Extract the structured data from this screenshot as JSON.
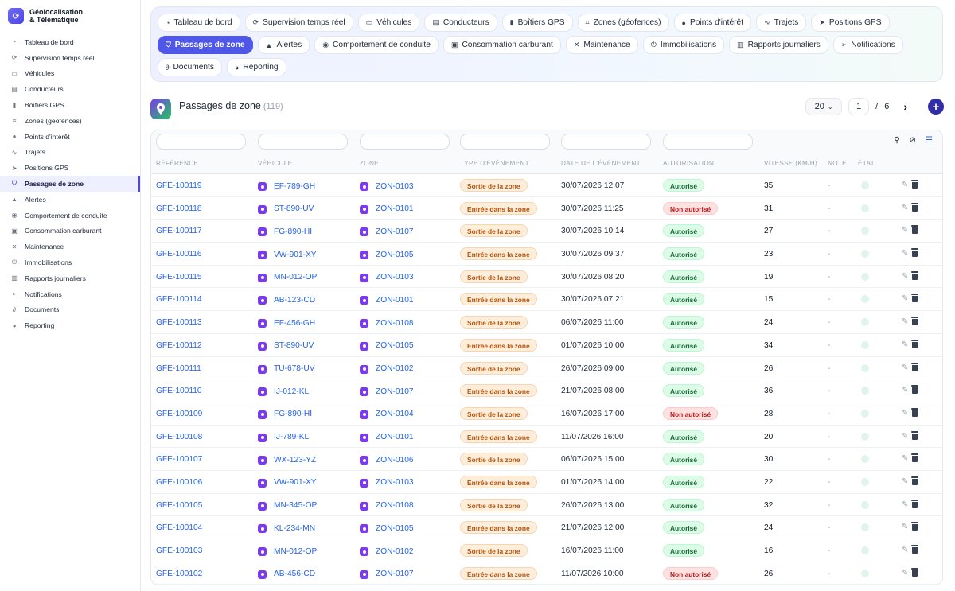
{
  "brand": {
    "line1": "Géolocalisation",
    "line2": "& Télématique"
  },
  "sidebar": {
    "items": [
      {
        "label": "Tableau de bord",
        "icon": "gauge-icon",
        "glyph": "◔"
      },
      {
        "label": "Supervision temps réel",
        "icon": "satellite-icon",
        "glyph": "⟳"
      },
      {
        "label": "Véhicules",
        "icon": "car-icon",
        "glyph": "▭"
      },
      {
        "label": "Conducteurs",
        "icon": "id-card-icon",
        "glyph": "▤"
      },
      {
        "label": "Boîtiers GPS",
        "icon": "device-icon",
        "glyph": "▮"
      },
      {
        "label": "Zones (géofences)",
        "icon": "map-icon",
        "glyph": "⌗"
      },
      {
        "label": "Points d'intérêt",
        "icon": "pin-icon",
        "glyph": "●"
      },
      {
        "label": "Trajets",
        "icon": "route-icon",
        "glyph": "∿"
      },
      {
        "label": "Positions GPS",
        "icon": "navigation-icon",
        "glyph": "➤"
      },
      {
        "label": "Passages de zone",
        "icon": "shield-icon",
        "glyph": "⛉",
        "active": true
      },
      {
        "label": "Alertes",
        "icon": "bell-icon",
        "glyph": "▲"
      },
      {
        "label": "Comportement de conduite",
        "icon": "steering-icon",
        "glyph": "◉"
      },
      {
        "label": "Consommation carburant",
        "icon": "fuel-icon",
        "glyph": "▣"
      },
      {
        "label": "Maintenance",
        "icon": "wrench-icon",
        "glyph": "✕"
      },
      {
        "label": "Immobilisations",
        "icon": "power-icon",
        "glyph": "⏻"
      },
      {
        "label": "Rapports journaliers",
        "icon": "file-icon",
        "glyph": "▥"
      },
      {
        "label": "Notifications",
        "icon": "send-icon",
        "glyph": "➢"
      },
      {
        "label": "Documents",
        "icon": "paperclip-icon",
        "glyph": "∂"
      },
      {
        "label": "Reporting",
        "icon": "pie-chart-icon",
        "glyph": "◕"
      }
    ]
  },
  "tabs": [
    {
      "label": "Tableau de bord",
      "icon": "gauge-icon",
      "glyph": "◔"
    },
    {
      "label": "Supervision temps réel",
      "icon": "satellite-icon",
      "glyph": "⟳"
    },
    {
      "label": "Véhicules",
      "icon": "car-icon",
      "glyph": "▭"
    },
    {
      "label": "Conducteurs",
      "icon": "id-card-icon",
      "glyph": "▤"
    },
    {
      "label": "Boîtiers GPS",
      "icon": "device-icon",
      "glyph": "▮"
    },
    {
      "label": "Zones (géofences)",
      "icon": "map-icon",
      "glyph": "⌗"
    },
    {
      "label": "Points d'intérêt",
      "icon": "pin-icon",
      "glyph": "●"
    },
    {
      "label": "Trajets",
      "icon": "route-icon",
      "glyph": "∿"
    },
    {
      "label": "Positions GPS",
      "icon": "navigation-icon",
      "glyph": "➤"
    },
    {
      "label": "Passages de zone",
      "icon": "shield-icon",
      "glyph": "⛉",
      "active": true
    },
    {
      "label": "Alertes",
      "icon": "bell-icon",
      "glyph": "▲"
    },
    {
      "label": "Comportement de conduite",
      "icon": "steering-icon",
      "glyph": "◉"
    },
    {
      "label": "Consommation carburant",
      "icon": "fuel-icon",
      "glyph": "▣"
    },
    {
      "label": "Maintenance",
      "icon": "wrench-icon",
      "glyph": "✕"
    },
    {
      "label": "Immobilisations",
      "icon": "power-icon",
      "glyph": "⏻"
    },
    {
      "label": "Rapports journaliers",
      "icon": "file-icon",
      "glyph": "▥"
    },
    {
      "label": "Notifications",
      "icon": "send-icon",
      "glyph": "➢"
    },
    {
      "label": "Documents",
      "icon": "paperclip-icon",
      "glyph": "∂"
    },
    {
      "label": "Reporting",
      "icon": "pie-chart-icon",
      "glyph": "◕"
    }
  ],
  "page": {
    "title": "Passages de zone",
    "count": "(119)"
  },
  "pager": {
    "page_size": "20",
    "page": "1",
    "sep": "/",
    "total_pages": "6"
  },
  "table": {
    "columns": [
      "RÉFÉRENCE",
      "VÉHICULE",
      "ZONE",
      "TYPE D'ÉVÉNEMENT",
      "DATE DE L'ÉVÉNEMENT",
      "AUTORISATION",
      "VITESSE (KM/H)",
      "NOTE",
      "ÉTAT"
    ],
    "colors": {
      "link": "#2563eb",
      "exit_bg": "#fdeedc",
      "authorized_bg": "#dcfce7",
      "denied_bg": "#fee2e2"
    },
    "rows": [
      {
        "ref": "GFE-100119",
        "vehicle": "EF-789-GH",
        "zone": "ZON-0103",
        "event": "Sortie de la zone",
        "date": "30/07/2026 12:07",
        "auth": "Autorisé",
        "ok": true,
        "speed": "35",
        "note": "-"
      },
      {
        "ref": "GFE-100118",
        "vehicle": "ST-890-UV",
        "zone": "ZON-0101",
        "event": "Entrée dans la zone",
        "date": "30/07/2026 11:25",
        "auth": "Non autorisé",
        "ok": false,
        "speed": "31",
        "note": "-"
      },
      {
        "ref": "GFE-100117",
        "vehicle": "FG-890-HI",
        "zone": "ZON-0107",
        "event": "Sortie de la zone",
        "date": "30/07/2026 10:14",
        "auth": "Autorisé",
        "ok": true,
        "speed": "27",
        "note": "-"
      },
      {
        "ref": "GFE-100116",
        "vehicle": "VW-901-XY",
        "zone": "ZON-0105",
        "event": "Entrée dans la zone",
        "date": "30/07/2026 09:37",
        "auth": "Autorisé",
        "ok": true,
        "speed": "23",
        "note": "-"
      },
      {
        "ref": "GFE-100115",
        "vehicle": "MN-012-OP",
        "zone": "ZON-0103",
        "event": "Sortie de la zone",
        "date": "30/07/2026 08:20",
        "auth": "Autorisé",
        "ok": true,
        "speed": "19",
        "note": "-"
      },
      {
        "ref": "GFE-100114",
        "vehicle": "AB-123-CD",
        "zone": "ZON-0101",
        "event": "Entrée dans la zone",
        "date": "30/07/2026 07:21",
        "auth": "Autorisé",
        "ok": true,
        "speed": "15",
        "note": "-"
      },
      {
        "ref": "GFE-100113",
        "vehicle": "EF-456-GH",
        "zone": "ZON-0108",
        "event": "Sortie de la zone",
        "date": "06/07/2026 11:00",
        "auth": "Autorisé",
        "ok": true,
        "speed": "24",
        "note": "-"
      },
      {
        "ref": "GFE-100112",
        "vehicle": "ST-890-UV",
        "zone": "ZON-0105",
        "event": "Entrée dans la zone",
        "date": "01/07/2026 10:00",
        "auth": "Autorisé",
        "ok": true,
        "speed": "34",
        "note": "-"
      },
      {
        "ref": "GFE-100111",
        "vehicle": "TU-678-UV",
        "zone": "ZON-0102",
        "event": "Sortie de la zone",
        "date": "26/07/2026 09:00",
        "auth": "Autorisé",
        "ok": true,
        "speed": "26",
        "note": "-"
      },
      {
        "ref": "GFE-100110",
        "vehicle": "IJ-012-KL",
        "zone": "ZON-0107",
        "event": "Entrée dans la zone",
        "date": "21/07/2026 08:00",
        "auth": "Autorisé",
        "ok": true,
        "speed": "36",
        "note": "-"
      },
      {
        "ref": "GFE-100109",
        "vehicle": "FG-890-HI",
        "zone": "ZON-0104",
        "event": "Sortie de la zone",
        "date": "16/07/2026 17:00",
        "auth": "Non autorisé",
        "ok": false,
        "speed": "28",
        "note": "-"
      },
      {
        "ref": "GFE-100108",
        "vehicle": "IJ-789-KL",
        "zone": "ZON-0101",
        "event": "Entrée dans la zone",
        "date": "11/07/2026 16:00",
        "auth": "Autorisé",
        "ok": true,
        "speed": "20",
        "note": "-"
      },
      {
        "ref": "GFE-100107",
        "vehicle": "WX-123-YZ",
        "zone": "ZON-0106",
        "event": "Sortie de la zone",
        "date": "06/07/2026 15:00",
        "auth": "Autorisé",
        "ok": true,
        "speed": "30",
        "note": "-"
      },
      {
        "ref": "GFE-100106",
        "vehicle": "VW-901-XY",
        "zone": "ZON-0103",
        "event": "Entrée dans la zone",
        "date": "01/07/2026 14:00",
        "auth": "Autorisé",
        "ok": true,
        "speed": "22",
        "note": "-"
      },
      {
        "ref": "GFE-100105",
        "vehicle": "MN-345-OP",
        "zone": "ZON-0108",
        "event": "Sortie de la zone",
        "date": "26/07/2026 13:00",
        "auth": "Autorisé",
        "ok": true,
        "speed": "32",
        "note": "-"
      },
      {
        "ref": "GFE-100104",
        "vehicle": "KL-234-MN",
        "zone": "ZON-0105",
        "event": "Entrée dans la zone",
        "date": "21/07/2026 12:00",
        "auth": "Autorisé",
        "ok": true,
        "speed": "24",
        "note": "-"
      },
      {
        "ref": "GFE-100103",
        "vehicle": "MN-012-OP",
        "zone": "ZON-0102",
        "event": "Sortie de la zone",
        "date": "16/07/2026 11:00",
        "auth": "Autorisé",
        "ok": true,
        "speed": "16",
        "note": "-"
      },
      {
        "ref": "GFE-100102",
        "vehicle": "AB-456-CD",
        "zone": "ZON-0107",
        "event": "Entrée dans la zone",
        "date": "11/07/2026 10:00",
        "auth": "Non autorisé",
        "ok": false,
        "speed": "26",
        "note": "-"
      }
    ]
  }
}
